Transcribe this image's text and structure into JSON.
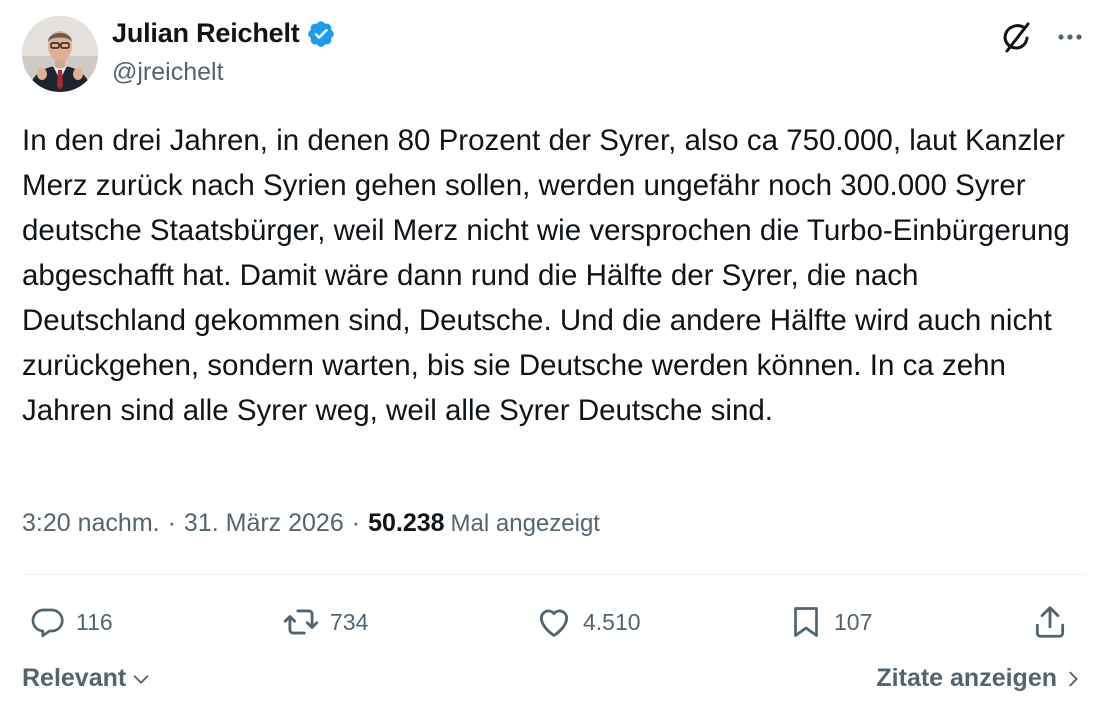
{
  "author": {
    "display_name": "Julian Reichelt",
    "handle": "@jreichelt",
    "verified": true,
    "avatar_icon": "avatar-photo"
  },
  "tweet": {
    "text": "In den drei Jahren, in denen 80 Prozent der Syrer, also ca 750.000, laut Kanzler Merz zurück nach Syrien gehen sollen, werden ungefähr noch 300.000 Syrer deutsche Staatsbürger, weil Merz nicht wie versprochen die Turbo-Einbürgerung abgeschafft hat. Damit wäre dann rund die Hälfte der Syrer, die nach Deutschland gekommen sind, Deutsche. Und die andere Hälfte wird auch nicht zurückgehen, sondern warten, bis sie Deutsche werden können. In ca zehn Jahren sind alle Syrer weg, weil alle Syrer Deutsche sind."
  },
  "meta": {
    "time": "3:20 nachm.",
    "separator": "·",
    "date": "31. März 2026",
    "views_count": "50.238",
    "views_label": "Mal angezeigt"
  },
  "actions": {
    "replies": "116",
    "reposts": "734",
    "likes": "4.510",
    "bookmarks": "107"
  },
  "footer": {
    "sort_label": "Relevant",
    "quotes_label": "Zitate anzeigen"
  },
  "colors": {
    "text_primary": "#0f1419",
    "text_secondary": "#536471",
    "verified_blue": "#1d9bf0",
    "divider": "#eff3f4"
  },
  "icons": [
    "grok-icon",
    "more-icon",
    "reply-icon",
    "repost-icon",
    "like-icon",
    "bookmark-icon",
    "share-icon",
    "chevron-down-icon",
    "chevron-right-icon",
    "verified-badge-icon"
  ]
}
